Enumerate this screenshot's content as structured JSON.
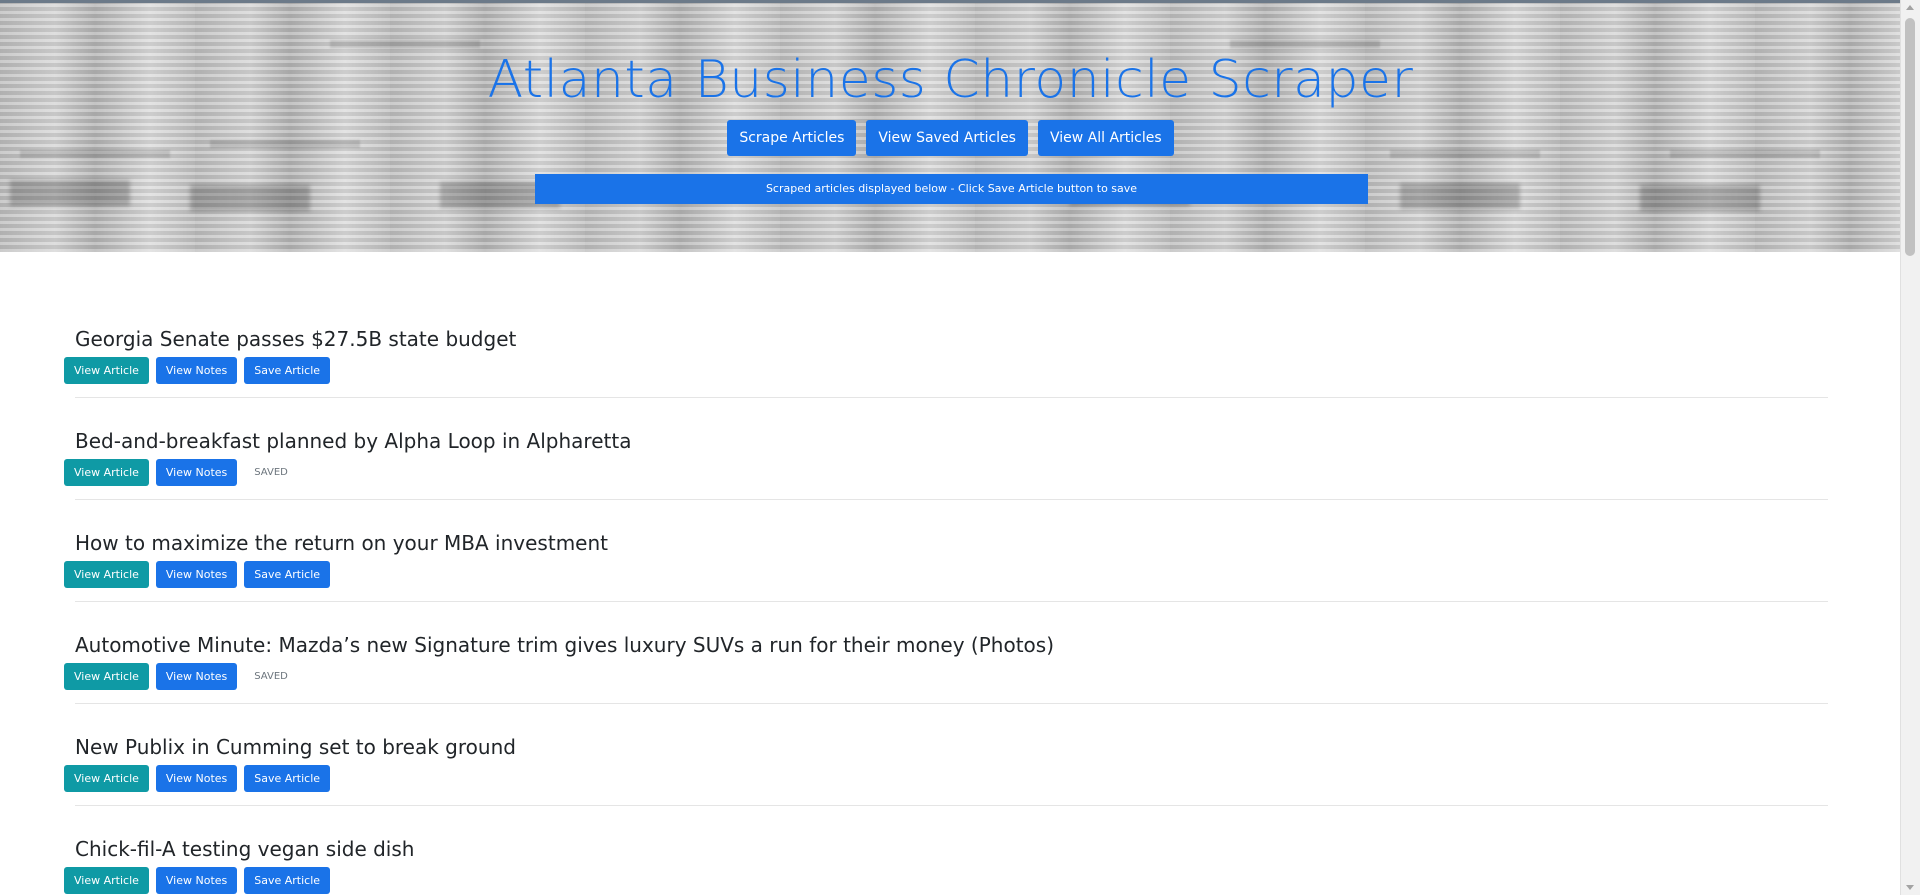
{
  "header": {
    "title": "Atlanta Business Chronicle Scraper",
    "buttons": {
      "scrape": "Scrape Articles",
      "view_saved": "View Saved Articles",
      "view_all": "View All Articles"
    },
    "banner": "Scraped articles displayed below - Click Save Article button to save"
  },
  "article_buttons": {
    "view_article": "View Article",
    "view_notes": "View Notes",
    "save_article": "Save Article",
    "saved_label": "SAVED"
  },
  "articles": [
    {
      "title": "Georgia Senate passes $27.5B state budget",
      "saved": false
    },
    {
      "title": "Bed-and-breakfast planned by Alpha Loop in Alpharetta",
      "saved": true
    },
    {
      "title": "How to maximize the return on your MBA investment",
      "saved": false
    },
    {
      "title": "Automotive Minute: Mazda’s new Signature trim gives luxury SUVs a run for their money (Photos)",
      "saved": true
    },
    {
      "title": "New Publix in Cumming set to break ground",
      "saved": false
    },
    {
      "title": "Chick-fil-A testing vegan side dish",
      "saved": false
    }
  ],
  "colors": {
    "primary": "#1a73e8",
    "info": "#0f9aa5",
    "muted": "#6c757d"
  }
}
